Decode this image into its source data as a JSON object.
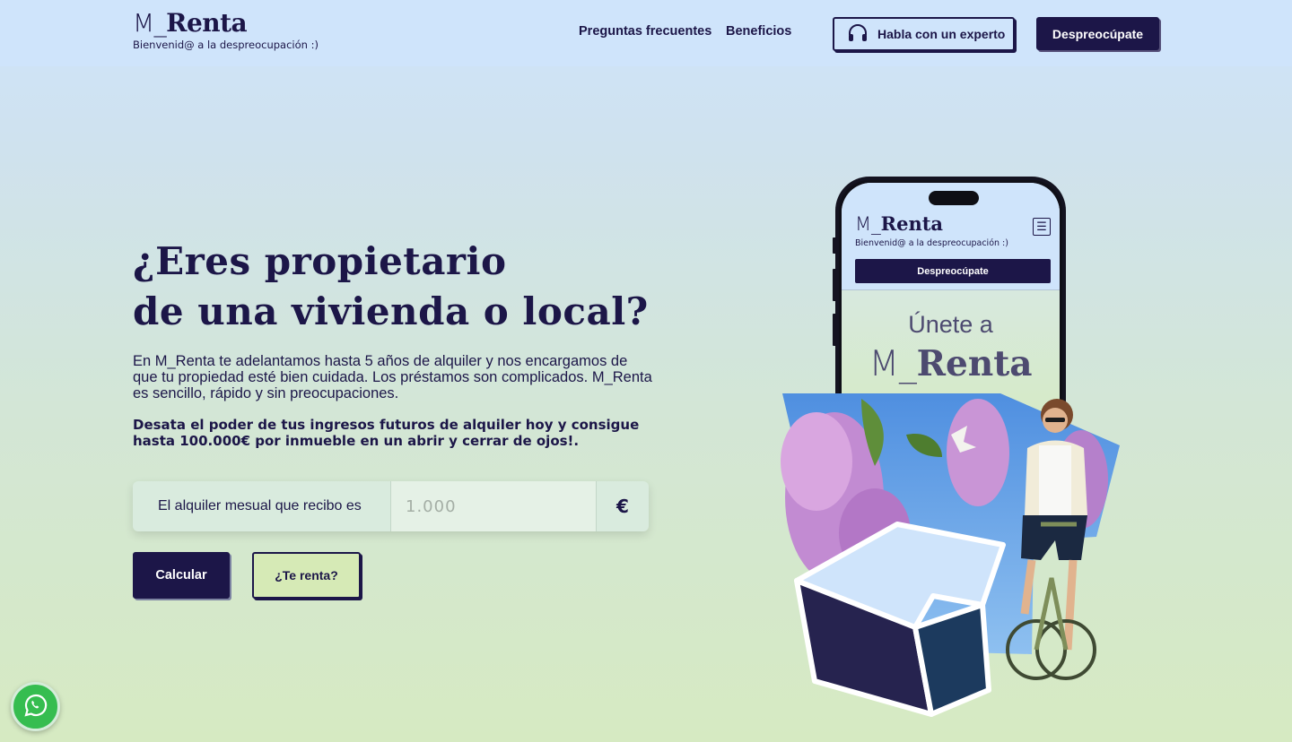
{
  "brand": {
    "logo_prefix": "M_",
    "logo_name": "Renta",
    "tagline": "Bienvenid@ a la despreocupación :)"
  },
  "nav": {
    "faq_label": "Preguntas frecuentes",
    "benefits_label": "Beneficios",
    "expert_label": "Habla con un experto",
    "cta_label": "Despreocúpate"
  },
  "hero": {
    "title_line1": "¿Eres propietario",
    "title_line2": "de una vivienda o local?",
    "intro": "En M_Renta te adelantamos hasta 5 años de alquiler y nos encargamos de que tu propiedad esté bien cuidada. Los préstamos son complicados. M_Renta es sencillo, rápido y sin preocupaciones.",
    "highlight": "Desata el poder de tus ingresos futuros de alquiler hoy y consigue hasta 100.000€ por inmueble en un abrir y cerrar de ojos!."
  },
  "calculator": {
    "label": "El alquiler mesual que recibo es",
    "placeholder": "1.000",
    "unit": "€",
    "calc_button": "Calcular",
    "renta_button": "¿Te renta?"
  },
  "phone_mockup": {
    "logo_prefix": "M_",
    "logo_name": "Renta",
    "tagline": "Bienvenid@ a la despreocupación :)",
    "cta": "Despreocúpate",
    "join_text": "Únete a",
    "brand_prefix": "M_",
    "brand_name": "Renta"
  },
  "icons": {
    "headset": "headset-icon",
    "menu": "hamburger-menu-icon",
    "whatsapp": "whatsapp-icon"
  },
  "colors": {
    "navy": "#1c1648",
    "nav_bg": "#cfe4fb",
    "light_green": "#d6eab6",
    "whatsapp_green": "#36bd50"
  }
}
